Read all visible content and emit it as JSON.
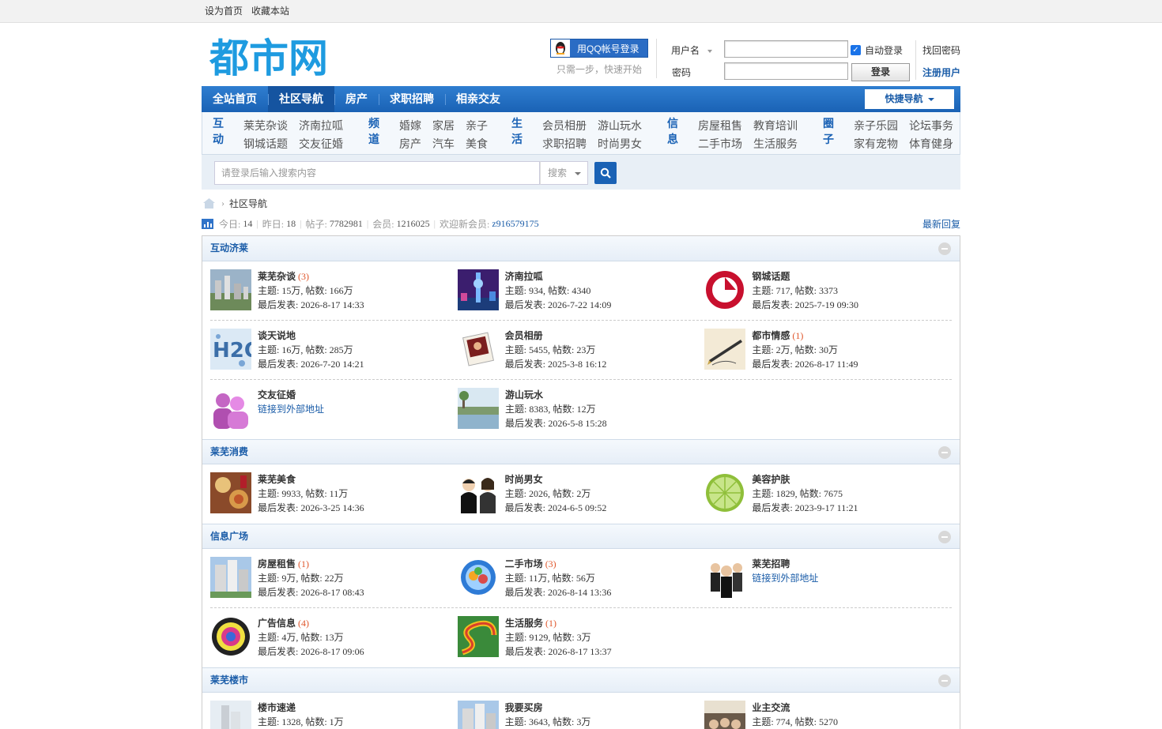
{
  "topbar": {
    "set_home": "设为首页",
    "bookmark": "收藏本站"
  },
  "header": {
    "logo_text": "都市网",
    "qq_login": "用QQ帐号登录",
    "qq_sub": "只需一步，快速开始",
    "username_label": "用户名",
    "password_label": "密码",
    "auto_login": "自动登录",
    "forgot": "找回密码",
    "login_btn": "登录",
    "register": "注册用户"
  },
  "nav": {
    "items": [
      "全站首页",
      "社区导航",
      "房产",
      "求职招聘",
      "相亲交友"
    ],
    "active": 1,
    "quick": "快捷导航"
  },
  "subnav": {
    "cats": [
      "互动",
      "频道",
      "生活",
      "信息",
      "圈子"
    ],
    "links": [
      [
        "莱芜杂谈",
        "济南拉呱",
        "钢城话题",
        "交友征婚"
      ],
      [
        "婚嫁",
        "家居",
        "亲子",
        "房产",
        "汽车",
        "美食"
      ],
      [
        "会员相册",
        "游山玩水",
        "求职招聘",
        "时尚男女"
      ],
      [
        "房屋租售",
        "教育培训",
        "二手市场",
        "生活服务"
      ],
      [
        "亲子乐园",
        "论坛事务",
        "家有宠物",
        "体育健身"
      ]
    ]
  },
  "search": {
    "placeholder": "请登录后输入搜索内容",
    "type": "搜索"
  },
  "crumb": {
    "current": "社区导航"
  },
  "stats": {
    "today_label": "今日:",
    "today": "14",
    "yesterday_label": "昨日:",
    "yesterday": "18",
    "posts_label": "帖子:",
    "posts": "7782981",
    "members_label": "会员:",
    "members": "1216025",
    "welcome_label": "欢迎新会员:",
    "new_member": "z916579175",
    "latest": "最新回复"
  },
  "groups": [
    {
      "title": "互动济莱",
      "rows": [
        [
          {
            "name": "莱芜杂谈",
            "today": "(3)",
            "stats": "主题: 15万, 帖数: 166万",
            "last": "最后发表: 2026-8-17 14:33",
            "thumb": "city"
          },
          {
            "name": "济南拉呱",
            "today": "",
            "stats": "主题: 934, 帖数: 4340",
            "last": "最后发表: 2026-7-22 14:09",
            "thumb": "tower"
          },
          {
            "name": "钢城话题",
            "today": "",
            "stats": "主题: 717, 帖数: 3373",
            "last": "最后发表: 2025-7-19 09:30",
            "thumb": "redlogo"
          }
        ],
        [
          {
            "name": "谈天说地",
            "today": "",
            "stats": "主题: 16万, 帖数: 285万",
            "last": "最后发表: 2026-7-20 14:21",
            "thumb": "h2o"
          },
          {
            "name": "会员相册",
            "today": "",
            "stats": "主题: 5455, 帖数: 23万",
            "last": "最后发表: 2025-3-8 16:12",
            "thumb": "photo"
          },
          {
            "name": "都市情感",
            "today": "(1)",
            "stats": "主题: 2万, 帖数: 30万",
            "last": "最后发表: 2026-8-17 11:49",
            "thumb": "pen"
          }
        ],
        [
          {
            "name": "交友征婚",
            "today": "",
            "ext": "链接到外部地址",
            "thumb": "users"
          },
          {
            "name": "游山玩水",
            "today": "",
            "stats": "主题: 8383, 帖数: 12万",
            "last": "最后发表: 2026-5-8 15:28",
            "thumb": "lake"
          }
        ]
      ]
    },
    {
      "title": "莱芜消费",
      "rows": [
        [
          {
            "name": "莱芜美食",
            "today": "",
            "stats": "主题: 9933, 帖数: 11万",
            "last": "最后发表: 2026-3-25 14:36",
            "thumb": "food"
          },
          {
            "name": "时尚男女",
            "today": "",
            "stats": "主题: 2026, 帖数: 2万",
            "last": "最后发表: 2024-6-5 09:52",
            "thumb": "couple"
          },
          {
            "name": "美容护肤",
            "today": "",
            "stats": "主题: 1829, 帖数: 7675",
            "last": "最后发表: 2023-9-17 11:21",
            "thumb": "lime"
          }
        ]
      ]
    },
    {
      "title": "信息广场",
      "rows": [
        [
          {
            "name": "房屋租售",
            "today": "(1)",
            "stats": "主题: 9万, 帖数: 22万",
            "last": "最后发表: 2026-8-17 08:43",
            "thumb": "building"
          },
          {
            "name": "二手市场",
            "today": "(3)",
            "stats": "主题: 11万, 帖数: 56万",
            "last": "最后发表: 2026-8-14 13:36",
            "thumb": "globe"
          },
          {
            "name": "莱芜招聘",
            "today": "",
            "ext": "链接到外部地址",
            "thumb": "people"
          }
        ],
        [
          {
            "name": "广告信息",
            "today": "(4)",
            "stats": "主题: 4万, 帖数: 13万",
            "last": "最后发表: 2026-8-17 09:06",
            "thumb": "badge"
          },
          {
            "name": "生活服务",
            "today": "(1)",
            "stats": "主题: 9129, 帖数: 3万",
            "last": "最后发表: 2026-8-17 13:37",
            "thumb": "spiral"
          }
        ]
      ]
    },
    {
      "title": "莱芜楼市",
      "rows": [
        [
          {
            "name": "楼市速递",
            "today": "",
            "stats": "主题: 1328, 帖数: 1万",
            "last": "",
            "thumb": "tower2"
          },
          {
            "name": "我要买房",
            "today": "",
            "stats": "主题: 3643, 帖数: 3万",
            "last": "",
            "thumb": "building"
          },
          {
            "name": "业主交流",
            "today": "",
            "stats": "主题: 774, 帖数: 5270",
            "last": "",
            "thumb": "meeting"
          }
        ]
      ]
    }
  ]
}
